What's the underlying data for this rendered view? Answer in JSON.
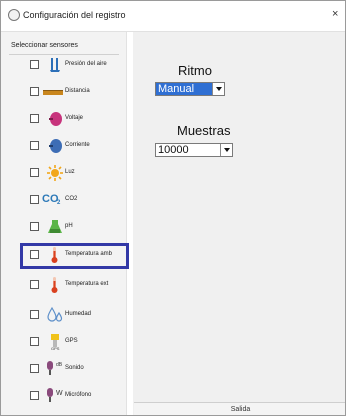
{
  "window": {
    "title": "Configuración del registro",
    "close_glyph": "×"
  },
  "sensors": {
    "panel_title": "Seleccionar sensores",
    "items": [
      {
        "label": "Presión del aire",
        "icon": "pressure-gauge-icon"
      },
      {
        "label": "Distancia",
        "icon": "distance-ruler-icon"
      },
      {
        "label": "Voltaje",
        "icon": "voltage-icon"
      },
      {
        "label": "Corriente",
        "icon": "current-icon"
      },
      {
        "label": "Luz",
        "icon": "light-sun-icon"
      },
      {
        "label": "CO2",
        "icon": "co2-icon"
      },
      {
        "label": "pH",
        "icon": "ph-icon"
      },
      {
        "label": "Temperatura amb",
        "icon": "thermometer-icon"
      },
      {
        "label": "Temperatura ext",
        "icon": "thermometer-icon"
      },
      {
        "label": "Humedad",
        "icon": "humidity-icon"
      },
      {
        "label": "GPS",
        "icon": "gps-icon"
      },
      {
        "label": "Sonido",
        "icon": "sound-microphone-icon"
      },
      {
        "label": "Micrófono",
        "icon": "microphone-icon"
      }
    ],
    "co2_icon_text": "CO",
    "co2_icon_sub": "2",
    "gps_icon_text": "GPS",
    "sound_icon_text": "dB",
    "mic_icon_text": "W"
  },
  "settings": {
    "ritmo_label": "Ritmo",
    "ritmo_value": "Manual",
    "muestras_label": "Muestras",
    "muestras_value": "10000"
  },
  "footer": {
    "exit_label": "Salida"
  },
  "colors": {
    "highlight_blue": "#3238a6",
    "selected_dropdown": "#2f6fd3"
  }
}
